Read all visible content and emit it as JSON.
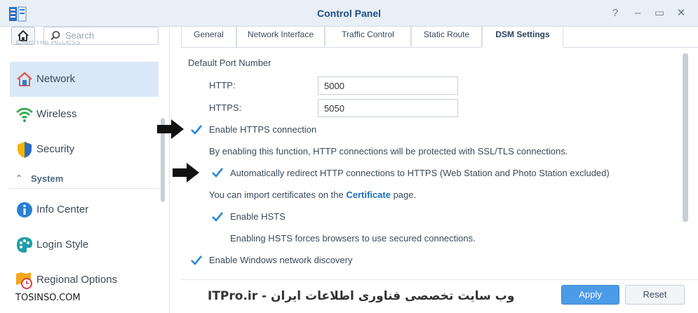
{
  "window": {
    "title": "Control Panel",
    "controls": {
      "help": "?",
      "minimize": "–",
      "maximize": "▭",
      "close": "✕"
    }
  },
  "sidebar": {
    "search_placeholder": "Search",
    "cut_item": "External Access",
    "items": [
      {
        "label": "Network",
        "icon": "network-house-icon",
        "active": true
      },
      {
        "label": "Wireless",
        "icon": "wifi-icon"
      },
      {
        "label": "Security",
        "icon": "shield-icon"
      }
    ],
    "group": {
      "label": "System",
      "icon": "chevron-up-icon"
    },
    "system_items": [
      {
        "label": "Info Center",
        "icon": "info-icon"
      },
      {
        "label": "Login Style",
        "icon": "palette-icon"
      },
      {
        "label": "Regional Options",
        "icon": "regional-map-clock-icon"
      }
    ]
  },
  "tabs": [
    "General",
    "Network Interface",
    "Traffic Control",
    "Static Route",
    "DSM Settings"
  ],
  "active_tab": "DSM Settings",
  "settings": {
    "section_title": "Default Port Number",
    "http_label": "HTTP:",
    "http_value": "5000",
    "https_label": "HTTPS:",
    "https_value": "5050",
    "enable_https": {
      "label": "Enable HTTPS connection",
      "checked": true
    },
    "https_desc": "By enabling this function, HTTP connections will be protected with SSL/TLS connections.",
    "redirect": {
      "label": "Automatically redirect HTTP connections to HTTPS (Web Station and Photo Station excluded)",
      "checked": true
    },
    "cert_text_prefix": "You can import certificates on the",
    "cert_link": "Certificate",
    "cert_text_suffix": "page.",
    "hsts": {
      "label": "Enable HSTS",
      "checked": true
    },
    "hsts_desc": "Enabling HSTS forces browsers to use secured connections.",
    "windows_discovery": {
      "label": "Enable Windows network discovery",
      "checked": true
    }
  },
  "buttons": {
    "apply": "Apply",
    "reset": "Reset"
  },
  "watermarks": {
    "left": "TOSINSO.COM",
    "right": "ITPro.ir - وب سایت تخصصی فناوری اطلاعات ایران"
  },
  "colors": {
    "accent": "#4b9be8",
    "title": "#1d4d86",
    "active_bg": "#d9e8f7",
    "check": "#2a86d8"
  }
}
